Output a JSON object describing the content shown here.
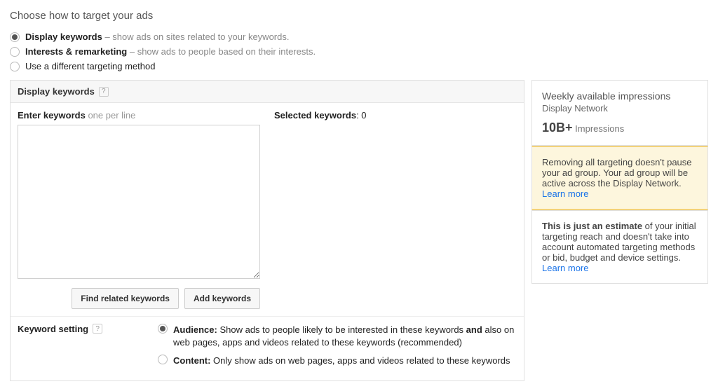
{
  "heading": "Choose how to target your ads",
  "radios": [
    {
      "label": "Display keywords",
      "desc": "– show ads on sites related to your keywords.",
      "selected": true
    },
    {
      "label": "Interests & remarketing",
      "desc": "– show ads to people based on their interests.",
      "selected": false
    },
    {
      "label": "Use a different targeting method",
      "desc": "",
      "selected": false
    }
  ],
  "panel": {
    "title": "Display keywords",
    "enter_label": "Enter keywords",
    "enter_hint": "one per line",
    "selected_label": "Selected keywords",
    "selected_count": "0",
    "find_btn": "Find related keywords",
    "add_btn": "Add keywords"
  },
  "setting": {
    "label": "Keyword setting",
    "opts": [
      {
        "selected": true,
        "lead": "Audience:",
        "text_a": " Show ads to people likely to be interested in these keywords ",
        "bold_mid": "and",
        "text_b": " also on web pages, apps and videos related to these keywords (recommended)"
      },
      {
        "selected": false,
        "lead": "Content:",
        "text_a": " Only show ads on web pages, apps and videos related to these keywords",
        "bold_mid": "",
        "text_b": ""
      }
    ]
  },
  "sidebar": {
    "impressions": {
      "title": "Weekly available impressions",
      "sub": "Display Network",
      "value": "10B+",
      "unit": "Impressions"
    },
    "warning": {
      "text": "Removing all targeting doesn't pause your ad group. Your ad group will be active across the Display Network.",
      "link": "Learn more"
    },
    "estimate": {
      "bold": "This is just an estimate",
      "rest": " of your initial targeting reach and doesn't take into account automated targeting methods or bid, budget and device settings.",
      "link": "Learn more"
    }
  },
  "help_icon_text": "?"
}
